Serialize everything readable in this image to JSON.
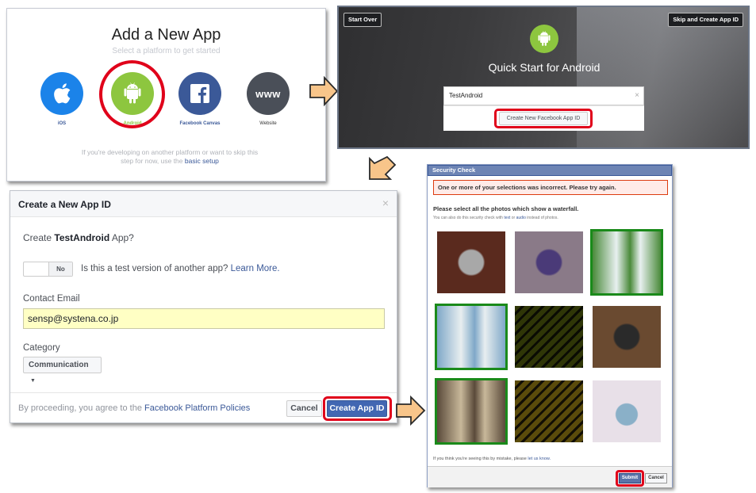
{
  "add_app": {
    "title": "Add a New App",
    "subtitle": "Select a platform to get started",
    "platforms": [
      {
        "label": "iOS",
        "icon": "apple-icon"
      },
      {
        "label": "Android",
        "icon": "android-icon"
      },
      {
        "label": "Facebook Canvas",
        "icon": "facebook-icon"
      },
      {
        "label": "Website",
        "icon": "www-icon",
        "glyph": "www"
      }
    ],
    "footnote_text": "If you're developing on another platform or want to skip this step for now, use the",
    "footnote_link": "basic setup"
  },
  "quick_start": {
    "start_over": "Start Over",
    "skip_create": "Skip and Create App ID",
    "title": "Quick Start for Android",
    "input_value": "TestAndroid",
    "clear_glyph": "×",
    "create_button": "Create New Facebook App ID"
  },
  "new_app_id": {
    "title": "Create a New App ID",
    "close_glyph": "×",
    "create_prefix": "Create",
    "app_name": "TestAndroid",
    "create_suffix": "App?",
    "toggle_label": "No",
    "test_question": "Is this a test version of another app?",
    "learn_more": "Learn More.",
    "email_label": "Contact Email",
    "email_value": "sensp@systena.co.jp",
    "category_label": "Category",
    "category_value": "Communication",
    "policy_prefix": "By proceeding, you agree to the",
    "policy_link": "Facebook Platform Policies",
    "cancel": "Cancel",
    "create": "Create App ID"
  },
  "security_check": {
    "title": "Security Check",
    "error": "One or more of your selections was incorrect. Please try again.",
    "instruction": "Please select all the photos which show a waterfall.",
    "alt_prefix": "You can also do this security check with",
    "alt_text_link": "text",
    "alt_or": "or",
    "alt_audio_link": "audio",
    "alt_suffix": "instead of photos.",
    "tiles": [
      {
        "subject": "watches",
        "selected": false,
        "colors": [
          "#5a2a1e",
          "#a8a8a8"
        ]
      },
      {
        "subject": "watch",
        "selected": false,
        "colors": [
          "#8a7a88",
          "#4a3a78"
        ]
      },
      {
        "subject": "waterfall",
        "selected": true,
        "colors": [
          "#4a8a3a",
          "#e8f0f0"
        ]
      },
      {
        "subject": "waterfall",
        "selected": true,
        "colors": [
          "#7fa8c8",
          "#e8eef0"
        ]
      },
      {
        "subject": "tiger",
        "selected": false,
        "colors": [
          "#3a6a2a",
          "#d0822a"
        ]
      },
      {
        "subject": "watch",
        "selected": false,
        "colors": [
          "#6a4a30",
          "#2a2a2a"
        ]
      },
      {
        "subject": "waterfall",
        "selected": true,
        "colors": [
          "#5a4a3a",
          "#c8b89a"
        ]
      },
      {
        "subject": "tiger",
        "selected": false,
        "colors": [
          "#6a8a3a",
          "#d88a30"
        ]
      },
      {
        "subject": "cat",
        "selected": false,
        "colors": [
          "#e8e0e8",
          "#8ab0c8"
        ]
      }
    ],
    "mistake_prefix": "If you think you're seeing this by mistake, please",
    "mistake_link": "let us know.",
    "submit": "Submit",
    "cancel": "Cancel"
  },
  "colors": {
    "facebook_blue": "#3b5998",
    "android_green": "#8dc63f",
    "ios_blue": "#1b83e9",
    "highlight_red": "#e0001a",
    "selected_green": "#1a8a1a",
    "arrow_fill": "#f8c58a"
  }
}
